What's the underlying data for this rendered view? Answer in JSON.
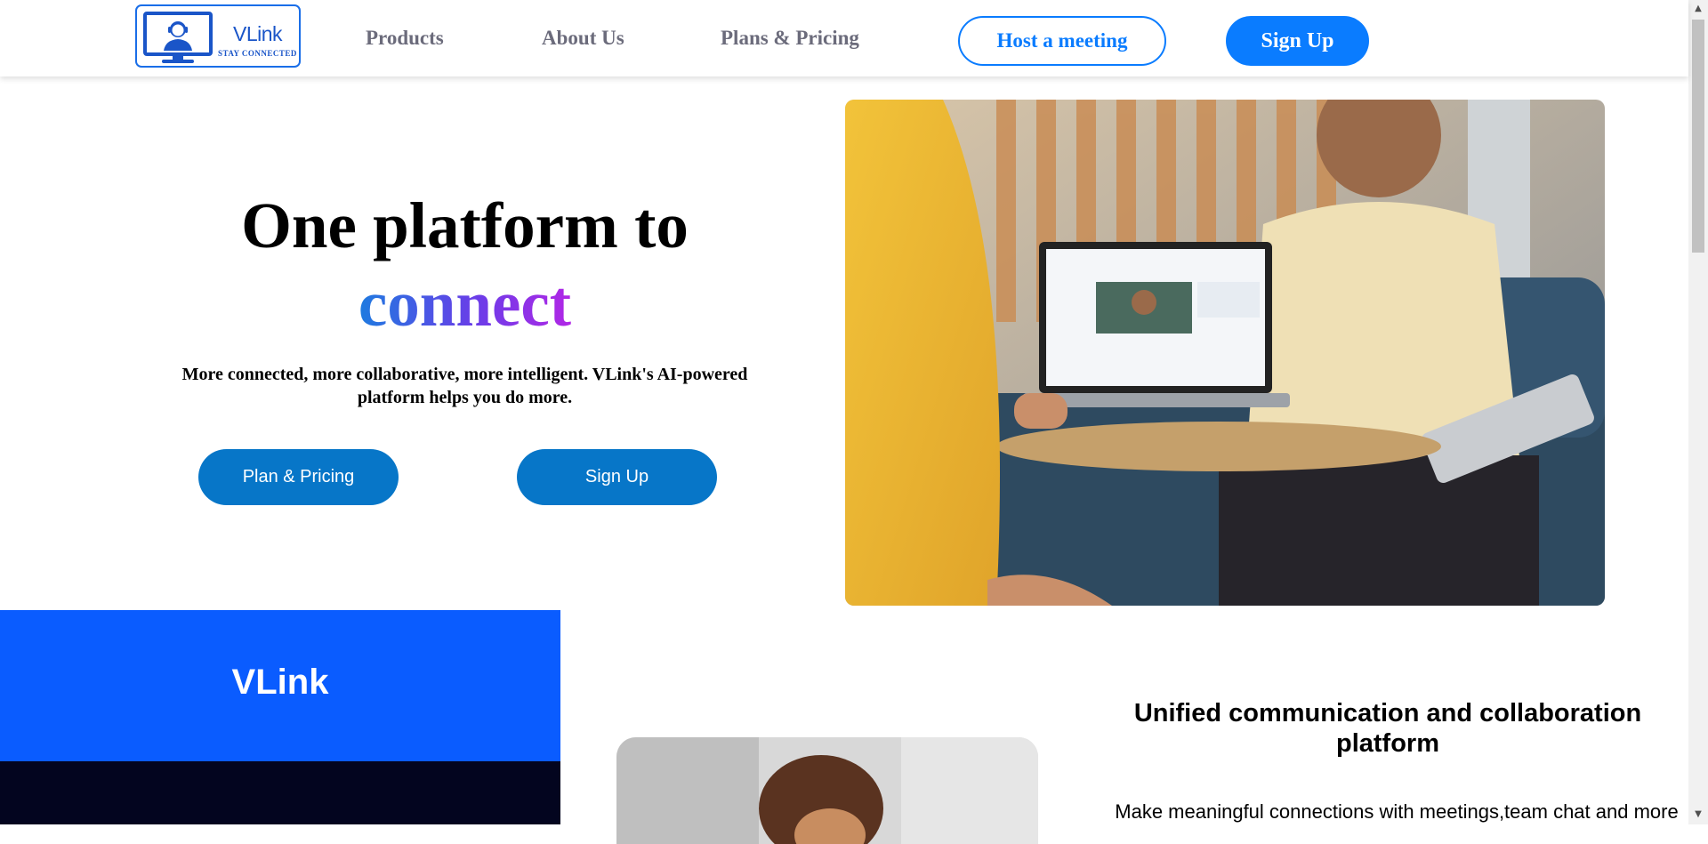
{
  "nav": {
    "logo_name": "VLink",
    "logo_tagline": "STAY CONNECTED",
    "links": [
      "Products",
      "About Us",
      "Plans & Pricing"
    ],
    "host_meeting": "Host a meeting",
    "sign_up": "Sign Up"
  },
  "hero": {
    "title_line1": "One platform to",
    "title_line2": "connect",
    "subtitle": "More connected, more collaborative, more intelligent. VLink's AI-powered platform helps you do more.",
    "btn_pricing": "Plan & Pricing",
    "btn_signup": "Sign Up"
  },
  "section2": {
    "brand": "VLink",
    "heading": "Unified communication and collaboration platform",
    "text": "Make meaningful connections with meetings,team chat and more"
  },
  "colors": {
    "primary": "#0a7cff",
    "hero_button": "#0776c8",
    "brand_box": "#0a5cff",
    "dark_box": "#03051f"
  }
}
